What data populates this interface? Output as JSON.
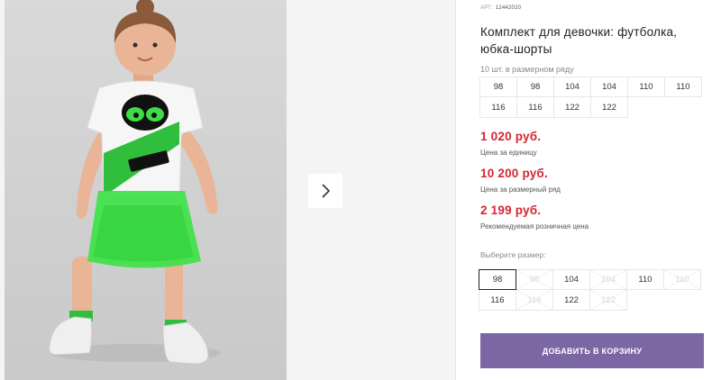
{
  "gallery": {
    "next_icon": "chevron-right-icon",
    "colors": {
      "tshirt": "#f6f6f6",
      "stripe": "#2fbf3c",
      "skirt": "#3fe24a",
      "skin": "#e9b596",
      "hair": "#8a5a3a",
      "shoes": "#ededed"
    }
  },
  "product": {
    "article_label": "АРТ:",
    "article_number": "12442020",
    "title": "Комплект для девочки: футболка, юбка-шорты",
    "pack_label": "10 шт. в размерном ряду",
    "pack_sizes": [
      "98",
      "98",
      "104",
      "104",
      "110",
      "110",
      "116",
      "116",
      "122",
      "122"
    ],
    "prices": [
      {
        "value": "1 020 руб.",
        "note": "Цена за единицу"
      },
      {
        "value": "10 200 руб.",
        "note": "Цена за размерный ряд"
      },
      {
        "value": "2 199 руб.",
        "note": "Рекомендуемая розничная цена"
      }
    ],
    "choose_label": "Выберите размер:",
    "size_options": [
      {
        "label": "98",
        "state": "selected"
      },
      {
        "label": "98",
        "state": "disabled"
      },
      {
        "label": "104",
        "state": "available"
      },
      {
        "label": "104",
        "state": "disabled"
      },
      {
        "label": "110",
        "state": "available"
      },
      {
        "label": "110",
        "state": "disabled"
      },
      {
        "label": "116",
        "state": "available"
      },
      {
        "label": "116",
        "state": "disabled"
      },
      {
        "label": "122",
        "state": "available"
      },
      {
        "label": "122",
        "state": "disabled"
      }
    ],
    "add_to_cart": "ДОБАВИТЬ В КОРЗИНУ",
    "colors": {
      "price": "#d32633",
      "button": "#7a67a3"
    }
  }
}
